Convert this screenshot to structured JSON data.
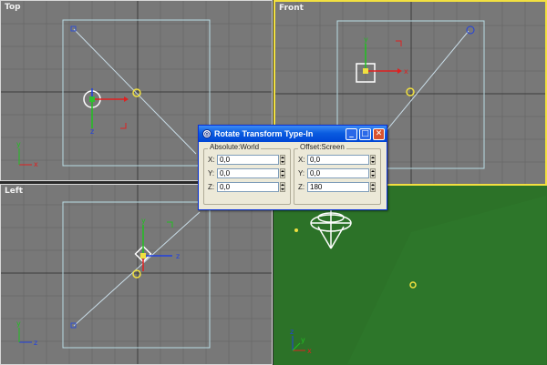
{
  "viewports": {
    "top": {
      "label": "Top"
    },
    "front": {
      "label": "Front"
    },
    "left": {
      "label": "Left"
    },
    "perspective": {
      "label": ""
    }
  },
  "axis_labels": {
    "x": "x",
    "y": "y",
    "z": "z"
  },
  "dialog": {
    "title": "Rotate Transform Type-In",
    "absolute": {
      "label": "Absolute:World",
      "rows": [
        {
          "axis": "X:",
          "value": "0,0"
        },
        {
          "axis": "Y:",
          "value": "0,0"
        },
        {
          "axis": "Z:",
          "value": "0,0"
        }
      ]
    },
    "offset": {
      "label": "Offset:Screen",
      "rows": [
        {
          "axis": "X:",
          "value": "0,0"
        },
        {
          "axis": "Y:",
          "value": "0,0"
        },
        {
          "axis": "Z:",
          "value": "180"
        }
      ]
    },
    "buttons": {
      "minimize": "_",
      "maximize": "□",
      "close": "✕"
    }
  },
  "colors": {
    "viewport_bg": "#787878",
    "grid_line": "#6a6a6a",
    "active_border": "#f2e040",
    "camera_frame": "#b8dce4",
    "perspective_bg": "#2c7228",
    "axis_x": "#e02020",
    "axis_y": "#20c020",
    "axis_z": "#2040e0",
    "target": "#f0e040"
  }
}
